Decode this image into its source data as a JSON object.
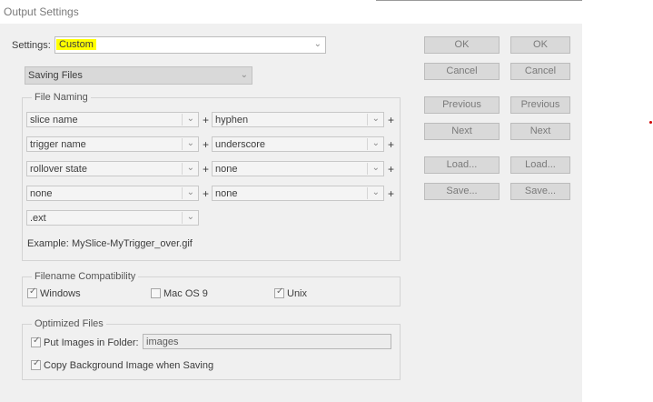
{
  "window": {
    "title": "Output Settings"
  },
  "settings": {
    "label": "Settings:",
    "value": "Custom"
  },
  "category": {
    "value": "Saving Files"
  },
  "file_naming": {
    "title": "File Naming",
    "plus": "+",
    "rows": [
      {
        "left": "slice name",
        "right": "hyphen"
      },
      {
        "left": "trigger name",
        "right": "underscore"
      },
      {
        "left": "rollover state",
        "right": "none"
      },
      {
        "left": "none",
        "right": "none"
      }
    ],
    "ext": ".ext",
    "example_label": "Example:",
    "example_value": "MySlice-MyTrigger_over.gif"
  },
  "compat": {
    "title": "Filename Compatibility",
    "windows": {
      "label": "Windows",
      "checked": true
    },
    "macos": {
      "label": "Mac OS 9",
      "checked": false
    },
    "unix": {
      "label": "Unix",
      "checked": true
    }
  },
  "optimized": {
    "title": "Optimized Files",
    "put_images": {
      "label": "Put Images in Folder:",
      "checked": true
    },
    "folder": "images",
    "copy_bg": {
      "label": "Copy Background Image when Saving",
      "checked": true
    }
  },
  "buttons": {
    "ok": "OK",
    "cancel": "Cancel",
    "previous": "Previous",
    "next": "Next",
    "load": "Load...",
    "save": "Save..."
  },
  "icons": {
    "dropdown": "chevron-down-icon",
    "checkbox": "checkmark-icon"
  },
  "colors": {
    "highlight": "#ffff00",
    "dialog_bg": "#f0f0f0",
    "button_bg": "#d9d9d9",
    "marker": "#d00000"
  }
}
